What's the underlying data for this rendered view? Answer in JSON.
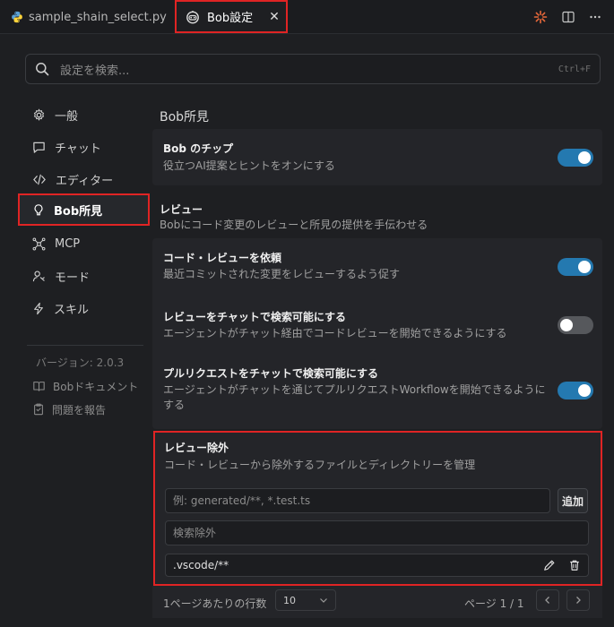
{
  "tabs": {
    "file_name": "sample_shain_select.py",
    "settings_title": "Bob設定",
    "close_glyph": "✕"
  },
  "search": {
    "placeholder": "設定を検索...",
    "shortcut": "Ctrl+F"
  },
  "sidebar": {
    "items": [
      {
        "label": "一般",
        "icon": "gear-icon"
      },
      {
        "label": "チャット",
        "icon": "chat-icon"
      },
      {
        "label": "エディター",
        "icon": "code-icon"
      },
      {
        "label": "Bob所見",
        "icon": "lightbulb-icon",
        "active": true
      },
      {
        "label": "MCP",
        "icon": "network-icon"
      },
      {
        "label": "モード",
        "icon": "user-mode-icon"
      },
      {
        "label": "スキル",
        "icon": "lightning-icon"
      }
    ],
    "version": "バージョン: 2.0.3",
    "docs": "Bobドキュメント",
    "report": "問題を報告"
  },
  "content": {
    "section_title": "Bob所見",
    "tips": {
      "title": "Bob のチップ",
      "desc": "役立つAI提案とヒントをオンにする",
      "enabled": true
    },
    "review": {
      "title": "レビュー",
      "desc": "Bobにコード変更のレビューと所見の提供を手伝わせる"
    },
    "request_review": {
      "title": "コード・レビューを依頼",
      "desc": "最近コミットされた変更をレビューするよう促す",
      "enabled": true
    },
    "chat_review": {
      "title": "レビューをチャットで検索可能にする",
      "desc": "エージェントがチャット経由でコードレビューを開始できるようにする",
      "enabled": false
    },
    "chat_pr": {
      "title": "プルリクエストをチャットで検索可能にする",
      "desc_line1": "エージェントがチャットを通じてプルリクエストWorkflowを開始できるように",
      "desc_line2": "する",
      "enabled": true
    },
    "exclusion": {
      "title": "レビュー除外",
      "desc": "コード・レビューから除外するファイルとディレクトリーを管理",
      "pattern_placeholder": "例: generated/**, *.test.ts",
      "add_label": "追加",
      "search_placeholder": "検索除外",
      "items": [
        ".vscode/**"
      ]
    },
    "pagination": {
      "rows_label": "1ページあたりの行数",
      "rows_value": "10",
      "page_info": "ページ 1 / 1"
    }
  },
  "colors": {
    "accent": "#2479b0",
    "highlight": "#e02424",
    "bob_orange": "#e8683a"
  }
}
